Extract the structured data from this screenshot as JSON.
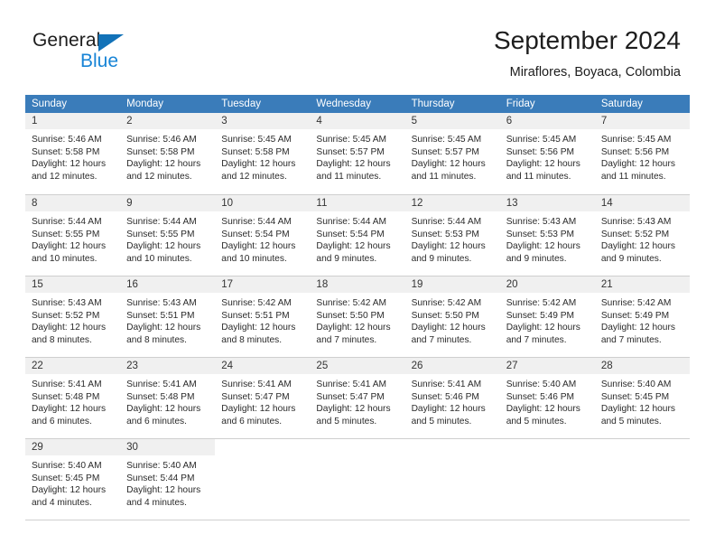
{
  "brand": {
    "name_part1": "General",
    "name_part2": "Blue",
    "accent_color": "#1784d6",
    "triangle_color": "#1272b8"
  },
  "header": {
    "title": "September 2024",
    "location": "Miraflores, Boyaca, Colombia"
  },
  "calendar": {
    "header_bg": "#3a7cba",
    "weekdays": [
      "Sunday",
      "Monday",
      "Tuesday",
      "Wednesday",
      "Thursday",
      "Friday",
      "Saturday"
    ],
    "weeks": [
      [
        {
          "date": "1",
          "sunrise": "Sunrise: 5:46 AM",
          "sunset": "Sunset: 5:58 PM",
          "daylight1": "Daylight: 12 hours",
          "daylight2": "and 12 minutes."
        },
        {
          "date": "2",
          "sunrise": "Sunrise: 5:46 AM",
          "sunset": "Sunset: 5:58 PM",
          "daylight1": "Daylight: 12 hours",
          "daylight2": "and 12 minutes."
        },
        {
          "date": "3",
          "sunrise": "Sunrise: 5:45 AM",
          "sunset": "Sunset: 5:58 PM",
          "daylight1": "Daylight: 12 hours",
          "daylight2": "and 12 minutes."
        },
        {
          "date": "4",
          "sunrise": "Sunrise: 5:45 AM",
          "sunset": "Sunset: 5:57 PM",
          "daylight1": "Daylight: 12 hours",
          "daylight2": "and 11 minutes."
        },
        {
          "date": "5",
          "sunrise": "Sunrise: 5:45 AM",
          "sunset": "Sunset: 5:57 PM",
          "daylight1": "Daylight: 12 hours",
          "daylight2": "and 11 minutes."
        },
        {
          "date": "6",
          "sunrise": "Sunrise: 5:45 AM",
          "sunset": "Sunset: 5:56 PM",
          "daylight1": "Daylight: 12 hours",
          "daylight2": "and 11 minutes."
        },
        {
          "date": "7",
          "sunrise": "Sunrise: 5:45 AM",
          "sunset": "Sunset: 5:56 PM",
          "daylight1": "Daylight: 12 hours",
          "daylight2": "and 11 minutes."
        }
      ],
      [
        {
          "date": "8",
          "sunrise": "Sunrise: 5:44 AM",
          "sunset": "Sunset: 5:55 PM",
          "daylight1": "Daylight: 12 hours",
          "daylight2": "and 10 minutes."
        },
        {
          "date": "9",
          "sunrise": "Sunrise: 5:44 AM",
          "sunset": "Sunset: 5:55 PM",
          "daylight1": "Daylight: 12 hours",
          "daylight2": "and 10 minutes."
        },
        {
          "date": "10",
          "sunrise": "Sunrise: 5:44 AM",
          "sunset": "Sunset: 5:54 PM",
          "daylight1": "Daylight: 12 hours",
          "daylight2": "and 10 minutes."
        },
        {
          "date": "11",
          "sunrise": "Sunrise: 5:44 AM",
          "sunset": "Sunset: 5:54 PM",
          "daylight1": "Daylight: 12 hours",
          "daylight2": "and 9 minutes."
        },
        {
          "date": "12",
          "sunrise": "Sunrise: 5:44 AM",
          "sunset": "Sunset: 5:53 PM",
          "daylight1": "Daylight: 12 hours",
          "daylight2": "and 9 minutes."
        },
        {
          "date": "13",
          "sunrise": "Sunrise: 5:43 AM",
          "sunset": "Sunset: 5:53 PM",
          "daylight1": "Daylight: 12 hours",
          "daylight2": "and 9 minutes."
        },
        {
          "date": "14",
          "sunrise": "Sunrise: 5:43 AM",
          "sunset": "Sunset: 5:52 PM",
          "daylight1": "Daylight: 12 hours",
          "daylight2": "and 9 minutes."
        }
      ],
      [
        {
          "date": "15",
          "sunrise": "Sunrise: 5:43 AM",
          "sunset": "Sunset: 5:52 PM",
          "daylight1": "Daylight: 12 hours",
          "daylight2": "and 8 minutes."
        },
        {
          "date": "16",
          "sunrise": "Sunrise: 5:43 AM",
          "sunset": "Sunset: 5:51 PM",
          "daylight1": "Daylight: 12 hours",
          "daylight2": "and 8 minutes."
        },
        {
          "date": "17",
          "sunrise": "Sunrise: 5:42 AM",
          "sunset": "Sunset: 5:51 PM",
          "daylight1": "Daylight: 12 hours",
          "daylight2": "and 8 minutes."
        },
        {
          "date": "18",
          "sunrise": "Sunrise: 5:42 AM",
          "sunset": "Sunset: 5:50 PM",
          "daylight1": "Daylight: 12 hours",
          "daylight2": "and 7 minutes."
        },
        {
          "date": "19",
          "sunrise": "Sunrise: 5:42 AM",
          "sunset": "Sunset: 5:50 PM",
          "daylight1": "Daylight: 12 hours",
          "daylight2": "and 7 minutes."
        },
        {
          "date": "20",
          "sunrise": "Sunrise: 5:42 AM",
          "sunset": "Sunset: 5:49 PM",
          "daylight1": "Daylight: 12 hours",
          "daylight2": "and 7 minutes."
        },
        {
          "date": "21",
          "sunrise": "Sunrise: 5:42 AM",
          "sunset": "Sunset: 5:49 PM",
          "daylight1": "Daylight: 12 hours",
          "daylight2": "and 7 minutes."
        }
      ],
      [
        {
          "date": "22",
          "sunrise": "Sunrise: 5:41 AM",
          "sunset": "Sunset: 5:48 PM",
          "daylight1": "Daylight: 12 hours",
          "daylight2": "and 6 minutes."
        },
        {
          "date": "23",
          "sunrise": "Sunrise: 5:41 AM",
          "sunset": "Sunset: 5:48 PM",
          "daylight1": "Daylight: 12 hours",
          "daylight2": "and 6 minutes."
        },
        {
          "date": "24",
          "sunrise": "Sunrise: 5:41 AM",
          "sunset": "Sunset: 5:47 PM",
          "daylight1": "Daylight: 12 hours",
          "daylight2": "and 6 minutes."
        },
        {
          "date": "25",
          "sunrise": "Sunrise: 5:41 AM",
          "sunset": "Sunset: 5:47 PM",
          "daylight1": "Daylight: 12 hours",
          "daylight2": "and 5 minutes."
        },
        {
          "date": "26",
          "sunrise": "Sunrise: 5:41 AM",
          "sunset": "Sunset: 5:46 PM",
          "daylight1": "Daylight: 12 hours",
          "daylight2": "and 5 minutes."
        },
        {
          "date": "27",
          "sunrise": "Sunrise: 5:40 AM",
          "sunset": "Sunset: 5:46 PM",
          "daylight1": "Daylight: 12 hours",
          "daylight2": "and 5 minutes."
        },
        {
          "date": "28",
          "sunrise": "Sunrise: 5:40 AM",
          "sunset": "Sunset: 5:45 PM",
          "daylight1": "Daylight: 12 hours",
          "daylight2": "and 5 minutes."
        }
      ],
      [
        {
          "date": "29",
          "sunrise": "Sunrise: 5:40 AM",
          "sunset": "Sunset: 5:45 PM",
          "daylight1": "Daylight: 12 hours",
          "daylight2": "and 4 minutes."
        },
        {
          "date": "30",
          "sunrise": "Sunrise: 5:40 AM",
          "sunset": "Sunset: 5:44 PM",
          "daylight1": "Daylight: 12 hours",
          "daylight2": "and 4 minutes."
        },
        {
          "date": "",
          "sunrise": "",
          "sunset": "",
          "daylight1": "",
          "daylight2": ""
        },
        {
          "date": "",
          "sunrise": "",
          "sunset": "",
          "daylight1": "",
          "daylight2": ""
        },
        {
          "date": "",
          "sunrise": "",
          "sunset": "",
          "daylight1": "",
          "daylight2": ""
        },
        {
          "date": "",
          "sunrise": "",
          "sunset": "",
          "daylight1": "",
          "daylight2": ""
        },
        {
          "date": "",
          "sunrise": "",
          "sunset": "",
          "daylight1": "",
          "daylight2": ""
        }
      ]
    ]
  }
}
